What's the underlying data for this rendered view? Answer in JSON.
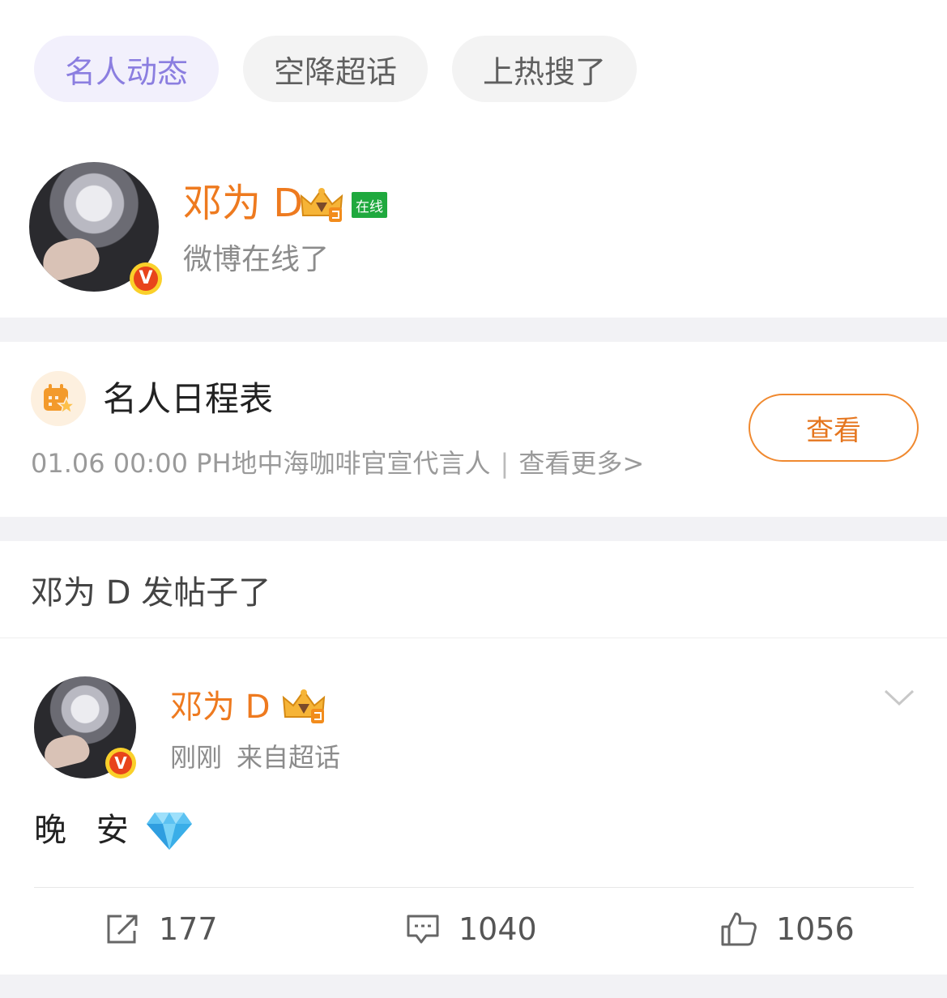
{
  "tabs": [
    {
      "label": "名人动态",
      "active": true
    },
    {
      "label": "空降超话",
      "active": false
    },
    {
      "label": "上热搜了",
      "active": false
    }
  ],
  "live_user": {
    "name": "邓为 D",
    "online_badge": "在线",
    "status": "微博在线了",
    "verified_mark": "V"
  },
  "schedule": {
    "title": "名人日程表",
    "info": "01.06 00:00 PH地中海咖啡官宣代言人",
    "divider": "|",
    "more": "查看更多>",
    "button": "查看"
  },
  "post_section": {
    "header": "邓为 D 发帖子了",
    "post": {
      "author": "邓为 D",
      "verified_mark": "V",
      "time": "刚刚",
      "source": "来自超话",
      "content": "晚 安",
      "emoji": "diamond-icon",
      "reposts": "177",
      "comments": "1040",
      "likes": "1056"
    }
  },
  "colors": {
    "accent_orange": "#ee7a1f",
    "active_tab_text": "#8b7ee0",
    "online_green": "#1fa93e",
    "verified_red": "#e8441b",
    "verified_gold": "#fad02a"
  }
}
